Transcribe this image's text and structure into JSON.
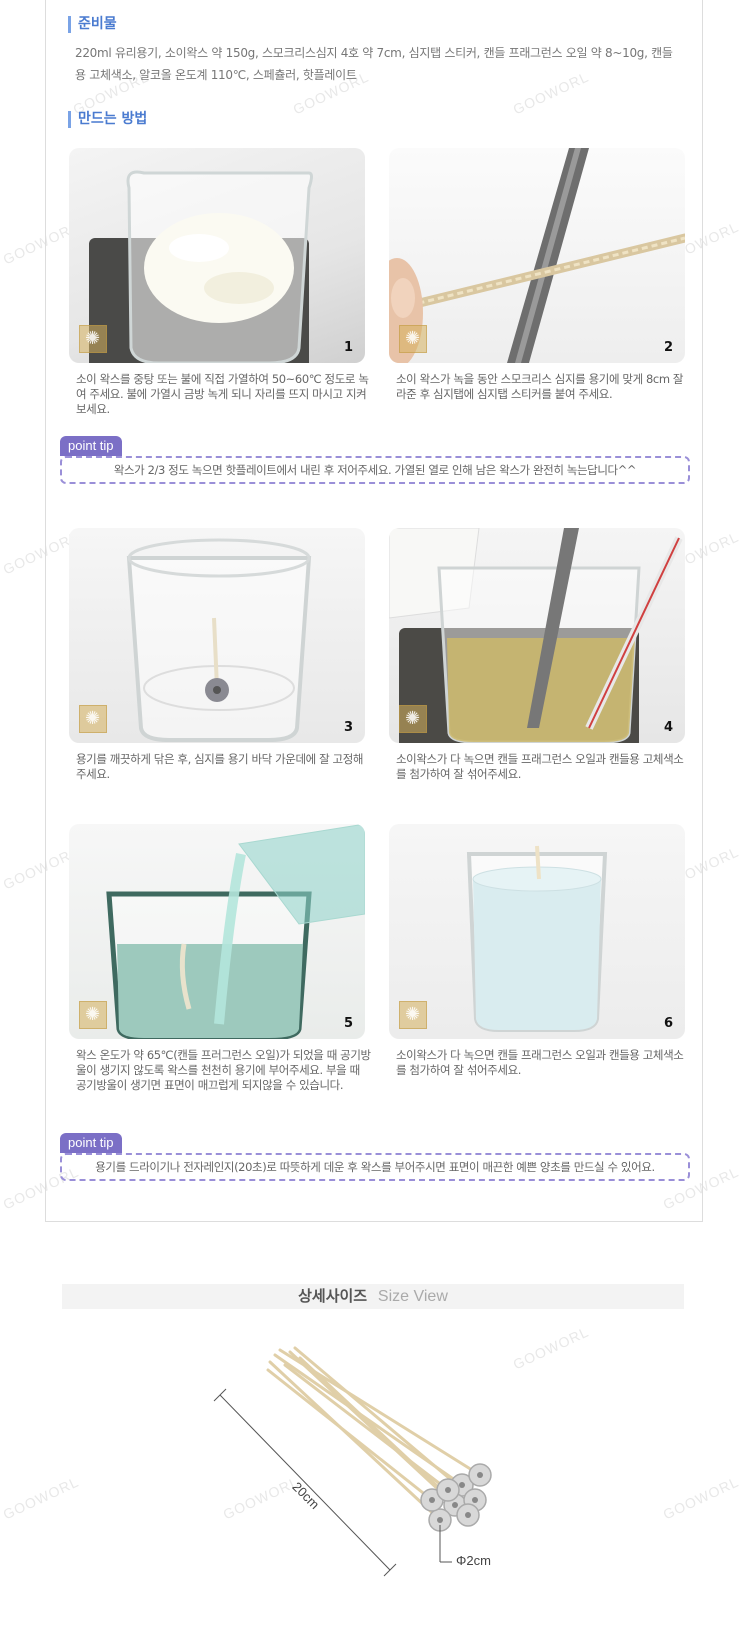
{
  "materials": {
    "heading": "준비물",
    "text": "220ml 유리용기, 소이왁스 약 150g, 스모크리스심지 4호 약 7cm, 심지탭 스티커, 캔들 프래그런스 오일 약 8~10g, 캔들용 고체색소, 알코올 온도계 110℃, 스페츌러, 핫플레이트"
  },
  "method": {
    "heading": "만드는 방법",
    "steps": [
      {
        "num": "1",
        "text": "소이 왁스를 중탕 또는 불에 직접 가열하여 50~60℃ 정도로 녹여 주세요. 불에 가열시 금방 녹게 되니 자리를 뜨지 마시고 지켜보세요."
      },
      {
        "num": "2",
        "text": "소이 왁스가 녹을 동안 스모크리스 심지를 용기에 맞게 8cm 잘라준 후 심지탭에 심지탭 스티커를 붙여 주세요."
      },
      {
        "num": "3",
        "text": "용기를 깨끗하게 닦은 후, 심지를 용기 바닥 가운데에 잘 고정해 주세요."
      },
      {
        "num": "4",
        "text": "소이왁스가 다 녹으면 캔들 프래그런스 오일과 캔들용 고체색소를 첨가하여 잘 섞어주세요."
      },
      {
        "num": "5",
        "text": "왁스 온도가 약 65℃(캔들 프러그런스 오일)가 되었을 때 공기방울이 생기지 않도록 왁스를 천천히 용기에 부어주세요. 부을 때 공기방울이 생기면 표면이 매끄럽게 되지않을 수 있습니다."
      },
      {
        "num": "6",
        "text": "소이왁스가 다 녹으면 캔들 프래그런스 오일과 캔들용 고체색소를 첨가하여 잘 섞어주세요."
      }
    ]
  },
  "tips": [
    {
      "label": "point tip",
      "text": "왁스가 2/3 정도 녹으면 핫플레이트에서 내린 후 저어주세요. 가열된 열로 인해 남은 왁스가 완전히 녹는답니다^^"
    },
    {
      "label": "point tip",
      "text": "용기를 드라이기나 전자레인지(20초)로 따뜻하게 데운 후 왁스를 부어주시면 표면이 매끈한 예쁜 양초를 만드실 수 있어요."
    }
  ],
  "size_view": {
    "title_ko": "상세사이즈",
    "title_en": "Size View",
    "length_label": "20cm",
    "diameter_label": "Φ2cm"
  },
  "watermark": "GOOWORL",
  "colors": {
    "accent": "#4a7bd0",
    "tip": "#7b6fc6",
    "tip_border": "#9a8fd8"
  }
}
